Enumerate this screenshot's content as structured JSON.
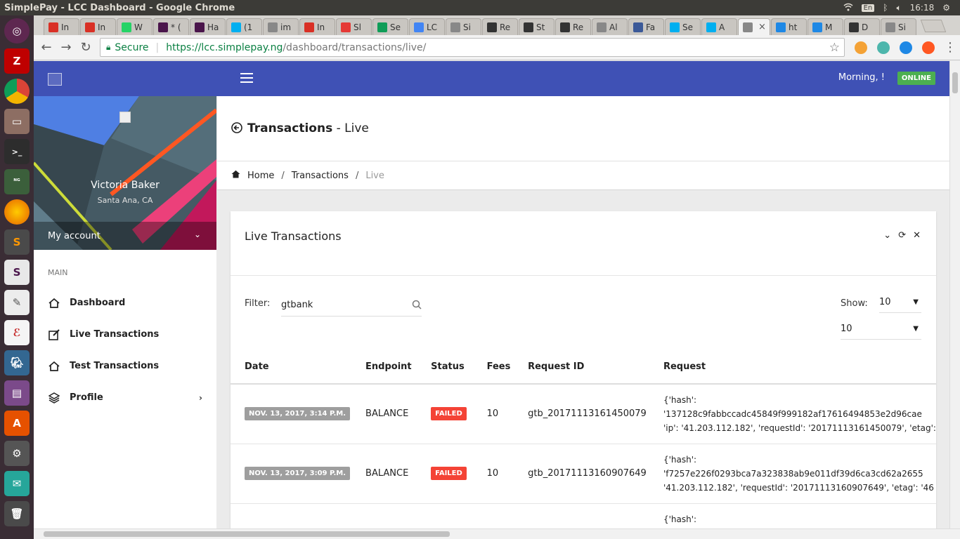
{
  "os": {
    "window_title": "SimplePay - LCC Dashboard - Google Chrome",
    "keyboard": "En",
    "clock": "16:18"
  },
  "tabs": [
    {
      "label": "In",
      "icon": "gmail-icon",
      "color": "#d93025"
    },
    {
      "label": "In",
      "icon": "gmail-icon",
      "color": "#d93025"
    },
    {
      "label": "W",
      "icon": "whatsapp-icon",
      "color": "#25d366"
    },
    {
      "label": "* (",
      "icon": "slack-icon",
      "color": "#4a154b"
    },
    {
      "label": "Ha",
      "icon": "slack-icon",
      "color": "#4a154b"
    },
    {
      "label": "(1",
      "icon": "skype-icon",
      "color": "#00aff0"
    },
    {
      "label": "im",
      "icon": "page-icon",
      "color": "#888888"
    },
    {
      "label": "In",
      "icon": "gmail-icon",
      "color": "#d93025"
    },
    {
      "label": "Sl",
      "icon": "pdf-icon",
      "color": "#e53935"
    },
    {
      "label": "Se",
      "icon": "drive-icon",
      "color": "#0f9d58"
    },
    {
      "label": "LC",
      "icon": "docs-icon",
      "color": "#4285f4"
    },
    {
      "label": "Si",
      "icon": "page-icon",
      "color": "#888888"
    },
    {
      "label": "Re",
      "icon": "stack-icon",
      "color": "#333333"
    },
    {
      "label": "St",
      "icon": "stack-icon",
      "color": "#333333"
    },
    {
      "label": "Re",
      "icon": "stack-icon",
      "color": "#333333"
    },
    {
      "label": "Al",
      "icon": "page-icon",
      "color": "#888888"
    },
    {
      "label": "Fa",
      "icon": "facebook-icon",
      "color": "#3b5998"
    },
    {
      "label": "Se",
      "icon": "skype-icon",
      "color": "#00aff0"
    },
    {
      "label": "A",
      "icon": "skype-icon",
      "color": "#00aff0"
    },
    {
      "label": "",
      "icon": "page-icon",
      "color": "#888888",
      "active": true
    },
    {
      "label": "ht",
      "icon": "d-icon",
      "color": "#1e88e5"
    },
    {
      "label": "M",
      "icon": "d-icon",
      "color": "#1e88e5"
    },
    {
      "label": "D",
      "icon": "menu-page-icon",
      "color": "#333333"
    },
    {
      "label": "Si",
      "icon": "page-icon",
      "color": "#888888"
    }
  ],
  "browser": {
    "secure_label": "Secure",
    "url_host": "https://lcc.simplepay.ng",
    "url_path": "/dashboard/transactions/live/"
  },
  "header": {
    "greeting": "Morning, !",
    "status": "ONLINE"
  },
  "profile": {
    "name": "Victoria Baker",
    "location": "Santa Ana, CA",
    "account_label": "My account"
  },
  "nav": {
    "section": "MAIN",
    "items": [
      {
        "label": "Dashboard",
        "icon": "home-icon"
      },
      {
        "label": "Live Transactions",
        "icon": "edit-icon"
      },
      {
        "label": "Test Transactions",
        "icon": "home-icon"
      },
      {
        "label": "Profile",
        "icon": "layers-icon"
      }
    ]
  },
  "page": {
    "title_main": "Transactions",
    "title_sub": "- Live",
    "breadcrumb": [
      "Home",
      "Transactions",
      "Live"
    ]
  },
  "card": {
    "title": "Live Transactions",
    "filter_label": "Filter:",
    "filter_value": "gtbank",
    "show_label": "Show:",
    "show_value": "10",
    "page_size_value": "10"
  },
  "table": {
    "columns": [
      "Date",
      "Endpoint",
      "Status",
      "Fees",
      "Request ID",
      "Request"
    ],
    "rows": [
      {
        "date": "NOV. 13, 2017, 3:14 P.M.",
        "endpoint": "BALANCE",
        "status": "FAILED",
        "fees": "10",
        "request_id": "gtb_20171113161450079",
        "request_lines": [
          "{'hash':",
          "'137128c9fabbccadc45849f999182af17616494853e2d96cae",
          "'ip': '41.203.112.182', 'requestId': '20171113161450079', 'etag':"
        ]
      },
      {
        "date": "NOV. 13, 2017, 3:09 P.M.",
        "endpoint": "BALANCE",
        "status": "FAILED",
        "fees": "10",
        "request_id": "gtb_20171113160907649",
        "request_lines": [
          "{'hash':",
          "'f7257e226f0293bca7a323838ab9e011df39d6ca3cd62a2655",
          "'41.203.112.182', 'requestId': '20171113160907649', 'etag': '46"
        ]
      },
      {
        "date": "",
        "endpoint": "",
        "status": "",
        "fees": "",
        "request_id": "",
        "request_lines": [
          "{'hash':",
          "",
          ""
        ]
      }
    ]
  },
  "colors": {
    "primary": "#3f51b5",
    "online": "#4caf50",
    "failed": "#f44336",
    "date_badge": "#9e9e9e"
  }
}
